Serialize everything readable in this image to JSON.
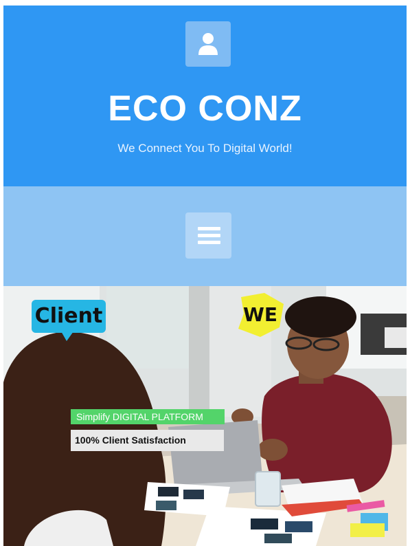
{
  "site": {
    "title": "ECO CONZ",
    "tagline": "We Connect You To Digital World!"
  },
  "header": {
    "avatar_icon": "user-icon",
    "background_color": "#2f97f3"
  },
  "nav": {
    "menu_icon": "hamburger-menu-icon",
    "background_color": "#8ec4f3"
  },
  "hero": {
    "bubble_client": "Client",
    "badge_we": "WE",
    "label_primary": "Simplify DIGITAL PLATFORM",
    "label_secondary": "100% Client Satisfaction"
  }
}
